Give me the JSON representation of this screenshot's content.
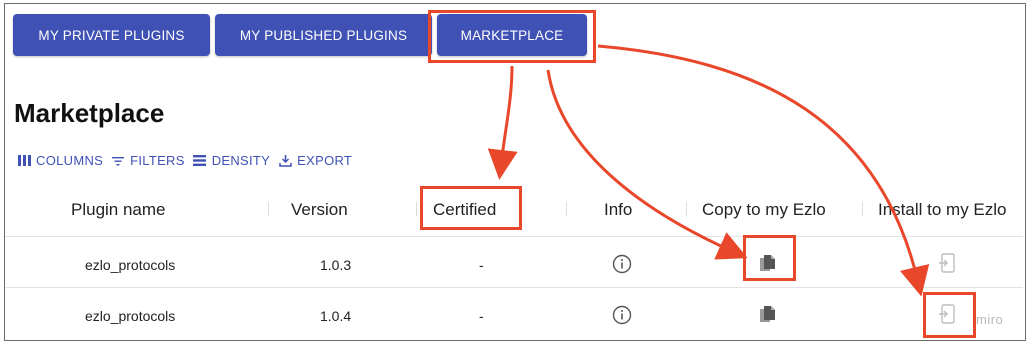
{
  "tabs": [
    {
      "label": "MY PRIVATE PLUGINS"
    },
    {
      "label": "MY PUBLISHED PLUGINS"
    },
    {
      "label": "MARKETPLACE"
    }
  ],
  "page_title": "Marketplace",
  "toolbar": {
    "columns": "COLUMNS",
    "filters": "FILTERS",
    "density": "DENSITY",
    "export": "EXPORT"
  },
  "table": {
    "headers": [
      "Plugin name",
      "Version",
      "Certified",
      "Info",
      "Copy to my Ezlo",
      "Install to my Ezlo"
    ],
    "rows": [
      {
        "plugin_name": "ezlo_protocols",
        "version": "1.0.3",
        "certified": "-"
      },
      {
        "plugin_name": "ezlo_protocols",
        "version": "1.0.4",
        "certified": "-"
      }
    ]
  },
  "watermark": "miro",
  "colors": {
    "accent": "#3f51b5",
    "annotation": "#e8472a"
  },
  "icons": [
    "columns-icon",
    "filter-icon",
    "density-icon",
    "export-icon",
    "info-icon",
    "copy-icon",
    "install-icon"
  ]
}
